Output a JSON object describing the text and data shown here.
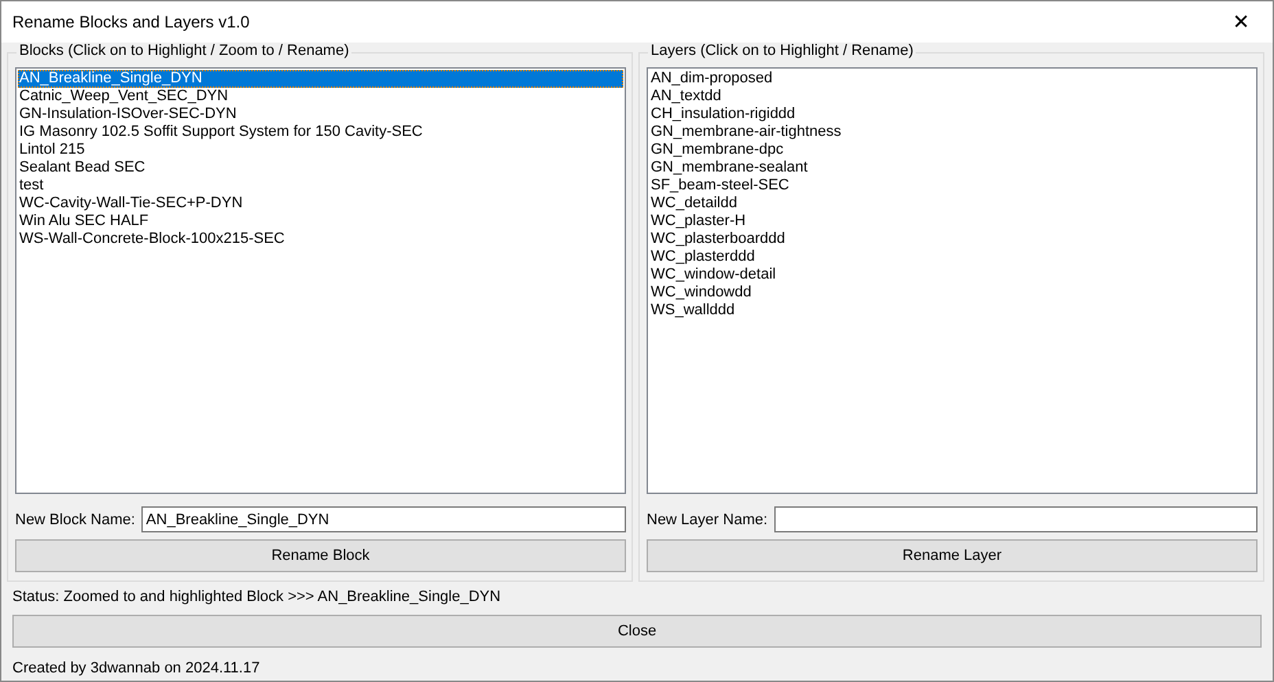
{
  "window": {
    "title": "Rename Blocks and Layers v1.0",
    "close": "✕"
  },
  "panels": [
    {
      "title": "Blocks (Click on to Highlight / Zoom to / Rename)",
      "field_label": "New Block Name:",
      "field_value": "AN_Breakline_Single_DYN",
      "button": "Rename Block",
      "items": [
        {
          "label": "AN_Breakline_Single_DYN",
          "selected": true
        },
        {
          "label": "Catnic_Weep_Vent_SEC_DYN",
          "selected": false
        },
        {
          "label": "GN-Insulation-ISOver-SEC-DYN",
          "selected": false
        },
        {
          "label": "IG Masonry 102.5 Soffit Support System for 150 Cavity-SEC",
          "selected": false
        },
        {
          "label": "Lintol 215",
          "selected": false
        },
        {
          "label": "Sealant Bead SEC",
          "selected": false
        },
        {
          "label": "test",
          "selected": false
        },
        {
          "label": "WC-Cavity-Wall-Tie-SEC+P-DYN",
          "selected": false
        },
        {
          "label": "Win Alu SEC HALF",
          "selected": false
        },
        {
          "label": "WS-Wall-Concrete-Block-100x215-SEC",
          "selected": false
        }
      ]
    },
    {
      "title": "Layers (Click on to Highlight / Rename)",
      "field_label": "New Layer Name:",
      "button": "Rename Layer",
      "items": [
        {
          "label": "AN_dim-proposed",
          "selected": false
        },
        {
          "label": "AN_textdd",
          "selected": false
        },
        {
          "label": "CH_insulation-rigiddd",
          "selected": false
        },
        {
          "label": "GN_membrane-air-tightness",
          "selected": false
        },
        {
          "label": "GN_membrane-dpc",
          "selected": false
        },
        {
          "label": "GN_membrane-sealant",
          "selected": false
        },
        {
          "label": "SF_beam-steel-SEC",
          "selected": false
        },
        {
          "label": "WC_detaildd",
          "selected": false
        },
        {
          "label": "WC_plaster-H",
          "selected": false
        },
        {
          "label": "WC_plasterboarddd",
          "selected": false
        },
        {
          "label": "WC_plasterddd",
          "selected": false
        },
        {
          "label": "WC_window-detail",
          "selected": false
        },
        {
          "label": "WC_windowdd",
          "selected": false
        },
        {
          "label": "WS_wallddd",
          "selected": false
        }
      ]
    }
  ],
  "status": "Status: Zoomed to and highlighted Block >>> AN_Breakline_Single_DYN",
  "close_button": "Close",
  "footer": "Created by 3dwannab on 2024.11.17"
}
